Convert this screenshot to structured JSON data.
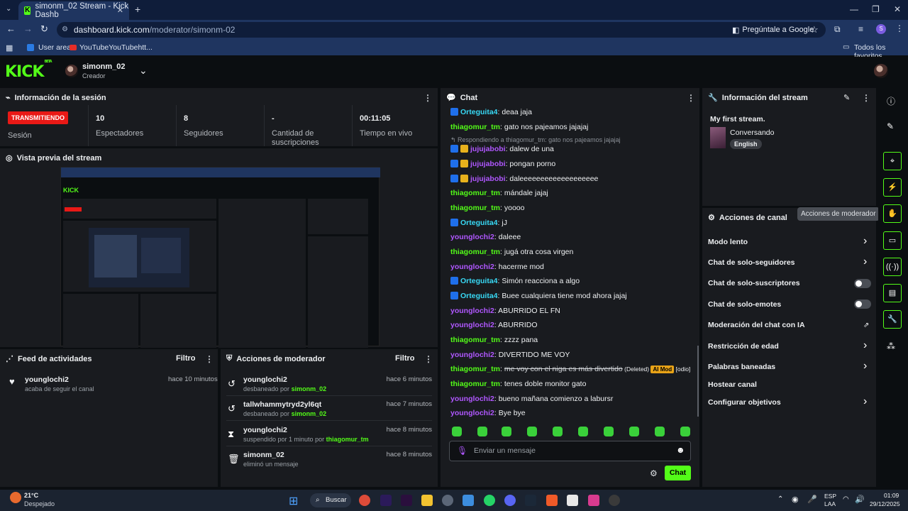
{
  "browser": {
    "tab_title": "simonm_02 Stream - Kick Dashb",
    "url_host": "dashboard.kick.com",
    "url_path": "/moderator/simonm-02",
    "ask_google": "Pregúntale a Google",
    "profile_initial": "S",
    "bookmarks": [
      "User area",
      "YouTubeYouTubehtt...",
      "Todos los favoritos"
    ]
  },
  "header": {
    "logo": "KICK",
    "logo_beta": "BETA",
    "user_name": "simonm_02",
    "user_role": "Creador"
  },
  "session": {
    "title": "Información de la sesión",
    "status_badge": "TRANSMITIENDO",
    "status_label": "Sesión",
    "stats": [
      {
        "value": "10",
        "label": "Espectadores"
      },
      {
        "value": "8",
        "label": "Seguidores"
      },
      {
        "value": "-",
        "label": "Cantidad de suscripciones"
      },
      {
        "value": "00:11:05",
        "label": "Tiempo en vivo"
      }
    ]
  },
  "preview": {
    "title": "Vista previa del stream"
  },
  "activity": {
    "title": "Feed de actividades",
    "filter": "Filtro",
    "items": [
      {
        "user": "younglochi2",
        "action": "acaba de seguir el canal",
        "time": "hace 10 minutos"
      }
    ]
  },
  "mod_actions": {
    "title": "Acciones de moderador",
    "filter": "Filtro",
    "items": [
      {
        "user": "younglochi2",
        "action": "desbaneado por",
        "by": "simonm_02",
        "time": "hace 6 minutos"
      },
      {
        "user": "tallwhammytryd2yl6qt",
        "action": "desbaneado por",
        "by": "simonm_02",
        "time": "hace 7 minutos"
      },
      {
        "user": "younglochi2",
        "action": "suspendido por 1 minuto por",
        "by": "thiagomur_tm",
        "time": "hace 8 minutos"
      },
      {
        "user": "simonm_02",
        "action": "eliminó un mensaje",
        "by": "",
        "time": "hace 8 minutos"
      }
    ]
  },
  "chat": {
    "title": "Chat",
    "reply_note": "Respondiendo a thiagomur_tm: gato nos pajeamos jajajaj",
    "placeholder": "Enviar un mensaje",
    "send": "Chat",
    "messages": [
      {
        "user": "Orteguita4",
        "text": "deaa jaja"
      },
      {
        "user": "thiagomur_tm",
        "text": "gato nos pajeamos jajajaj"
      },
      {
        "user": "jujujabobi",
        "text": "dalew de una"
      },
      {
        "user": "jujujabobi",
        "text": "pongan porno"
      },
      {
        "user": "jujujabobi",
        "text": "daleeeeeeeeeeeeeeeeeee"
      },
      {
        "user": "thiagomur_tm",
        "text": "mándale jajaj"
      },
      {
        "user": "thiagomur_tm",
        "text": "yoooo"
      },
      {
        "user": "Orteguita4",
        "text": "jJ"
      },
      {
        "user": "younglochi2",
        "text": "daleee"
      },
      {
        "user": "thiagomur_tm",
        "text": "jugá otra cosa virgen"
      },
      {
        "user": "younglochi2",
        "text": "hacerme mod"
      },
      {
        "user": "Orteguita4",
        "text": "Simón reacciona a algo"
      },
      {
        "user": "Orteguita4",
        "text": "Buee cualquiera tiene mod ahora jajaj"
      },
      {
        "user": "younglochi2",
        "text": "ABURRIDO EL FN"
      },
      {
        "user": "younglochi2",
        "text": "ABURRIDO"
      },
      {
        "user": "thiagomur_tm",
        "text": "zzzz pana"
      },
      {
        "user": "younglochi2",
        "text": "DIVERTIDO ME VOY"
      },
      {
        "user": "thiagomur_tm",
        "text": "me voy con el niga es más divertido",
        "deleted": "(Deleted)",
        "ai": "AI Mod",
        "tag": "[odio]"
      },
      {
        "user": "thiagomur_tm",
        "text": "tenes doble monitor gato"
      },
      {
        "user": "younglochi2",
        "text": "bueno mañana comienzo a labursr"
      },
      {
        "user": "younglochi2",
        "text": "Bye bye"
      }
    ]
  },
  "stream_info": {
    "title": "Información del stream",
    "stream_title": "My first stream.",
    "category": "Conversando",
    "language": "English"
  },
  "channel_actions": {
    "title": "Acciones de canal",
    "tooltip": "Acciones de moderador",
    "items": [
      {
        "label": "Modo lento",
        "control": "chevron"
      },
      {
        "label": "Chat de solo-seguidores",
        "control": "chevron"
      },
      {
        "label": "Chat de solo-suscriptores",
        "control": "toggle"
      },
      {
        "label": "Chat de solo-emotes",
        "control": "toggle"
      },
      {
        "label": "Moderación del chat con IA",
        "control": "external"
      },
      {
        "label": "Restricción de edad",
        "control": "chevron"
      },
      {
        "label": "Palabras baneadas",
        "control": "chevron"
      },
      {
        "label": "Hostear canal",
        "control": "none"
      },
      {
        "label": "Configurar objetivos",
        "control": "chevron"
      }
    ]
  },
  "taskbar": {
    "weather_temp": "21°C",
    "weather_desc": "Despejado",
    "search": "Buscar",
    "lang": "ESP",
    "lang2": "LAA",
    "time": "01:09",
    "date": "29/12/2025"
  },
  "colors": {
    "accent": "#53fc18",
    "live": "#e91916",
    "panel": "#191b1f",
    "bg": "#0b0e11"
  }
}
